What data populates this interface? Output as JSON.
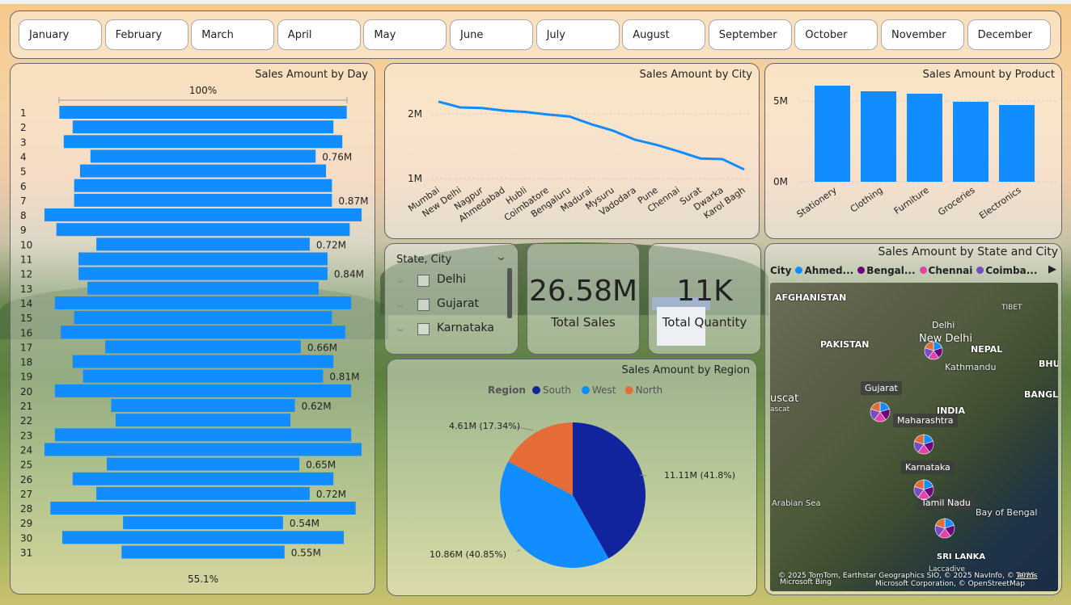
{
  "ribbon_hint": "",
  "months": [
    "January",
    "February",
    "March",
    "April",
    "May",
    "June",
    "July",
    "August",
    "September",
    "October",
    "November",
    "December"
  ],
  "day_chart": {
    "title": "Sales Amount by Day",
    "top_label": "100%",
    "bottom_label": "55.1%"
  },
  "city_chart": {
    "title": "Sales Amount by City"
  },
  "product_chart": {
    "title": "Sales Amount by Product"
  },
  "slicer": {
    "header": "State, City",
    "items": [
      "Delhi",
      "Gujarat",
      "Karnataka"
    ]
  },
  "kpis": [
    {
      "value": "26.58M",
      "label": "Total Sales"
    },
    {
      "value": "11K",
      "label": "Total Quantity"
    }
  ],
  "region_chart": {
    "title": "Sales Amount by Region",
    "legend_title": "Region"
  },
  "map": {
    "title": "Sales Amount by State and City",
    "legend_title": "City",
    "legend": [
      {
        "name": "Ahmed...",
        "color": "#118DFF"
      },
      {
        "name": "Bengal...",
        "color": "#6B007B"
      },
      {
        "name": "Chennai",
        "color": "#E044A7"
      },
      {
        "name": "Coimba...",
        "color": "#744EC2"
      }
    ],
    "labels": {
      "afghanistan": "AFGHANISTAN",
      "pakistan": "PAKISTAN",
      "tibet": "TIBET",
      "nepal": "NEPAL",
      "kathmandu": "Kathmandu",
      "bhu": "BHU",
      "bangl": "BANGL",
      "muscat": "uscat",
      "muscat2": "ascat",
      "india": "INDIA",
      "arabian_sea": "Arabian Sea",
      "bay_of_bengal": "Bay of Bengal",
      "sri_lanka": "SRI LANKA",
      "new_delhi": "New Delhi",
      "delhi": "Delhi",
      "gujarat": "Gujarat",
      "maharashtra": "Maharashtra",
      "karnataka": "Karnataka",
      "tamil_nadu": "Tamil Nadu",
      "lakshadweep": "Laccadive",
      "attribution1": "© 2025 TomTom, Earthstar Geographics SIO, © 2025 NavInfo, © 2025",
      "attribution2": "Microsoft Corporation, © OpenStreetMap",
      "terms": "Terms",
      "bing": "Microsoft Bing"
    }
  },
  "chart_data": [
    {
      "type": "bar",
      "title": "Sales Amount by Day",
      "orientation": "horizontal-centered-funnel",
      "categories": [
        "1",
        "2",
        "3",
        "4",
        "5",
        "6",
        "7",
        "8",
        "9",
        "10",
        "11",
        "12",
        "13",
        "14",
        "15",
        "16",
        "17",
        "18",
        "19",
        "20",
        "21",
        "22",
        "23",
        "24",
        "25",
        "26",
        "27",
        "28",
        "29",
        "30",
        "31"
      ],
      "values": [
        0.97,
        0.88,
        0.94,
        0.76,
        0.83,
        0.87,
        0.87,
        1.07,
        0.99,
        0.72,
        0.84,
        0.84,
        0.78,
        1.0,
        0.87,
        0.96,
        0.66,
        0.88,
        0.81,
        1.0,
        0.62,
        0.59,
        1.0,
        1.07,
        0.65,
        0.88,
        0.72,
        1.03,
        0.54,
        0.95,
        0.55
      ],
      "data_labels": {
        "4": "0.76M",
        "7": "0.87M",
        "10": "0.72M",
        "12": "0.84M",
        "17": "0.66M",
        "19": "0.81M",
        "21": "0.62M",
        "25": "0.65M",
        "27": "0.72M",
        "29": "0.54M",
        "31": "0.55M"
      }
    },
    {
      "type": "line",
      "title": "Sales Amount by City",
      "categories": [
        "Mumbai",
        "New Delhi",
        "Nagpur",
        "Ahmedabad",
        "Hubli",
        "Coimbatore",
        "Bengaluru",
        "Madurai",
        "Mysuru",
        "Vadodara",
        "Pune",
        "Chennai",
        "Surat",
        "Dwarka",
        "Karol Bagh"
      ],
      "values": [
        2.19,
        2.1,
        2.09,
        2.05,
        2.03,
        1.99,
        1.96,
        1.84,
        1.74,
        1.6,
        1.52,
        1.42,
        1.31,
        1.3,
        1.14
      ],
      "yticks": [
        "1M",
        "2M"
      ],
      "ylim": [
        0.9,
        2.4
      ]
    },
    {
      "type": "bar",
      "title": "Sales Amount by Product",
      "categories": [
        "Stationery",
        "Clothing",
        "Furniture",
        "Groceries",
        "Electronics"
      ],
      "values": [
        5.95,
        5.6,
        5.45,
        4.95,
        4.75
      ],
      "yticks": [
        "0M",
        "5M"
      ],
      "ylim": [
        0,
        6.5
      ]
    },
    {
      "type": "pie",
      "title": "Sales Amount by Region",
      "series": [
        {
          "name": "South",
          "value": 11.11,
          "label": "11.11M (41.8%)",
          "color": "#12239E"
        },
        {
          "name": "West",
          "value": 10.86,
          "label": "10.86M (40.85%)",
          "color": "#118DFF"
        },
        {
          "name": "North",
          "value": 4.61,
          "label": "4.61M (17.34%)",
          "color": "#E66C37"
        }
      ],
      "legend": "top"
    }
  ]
}
